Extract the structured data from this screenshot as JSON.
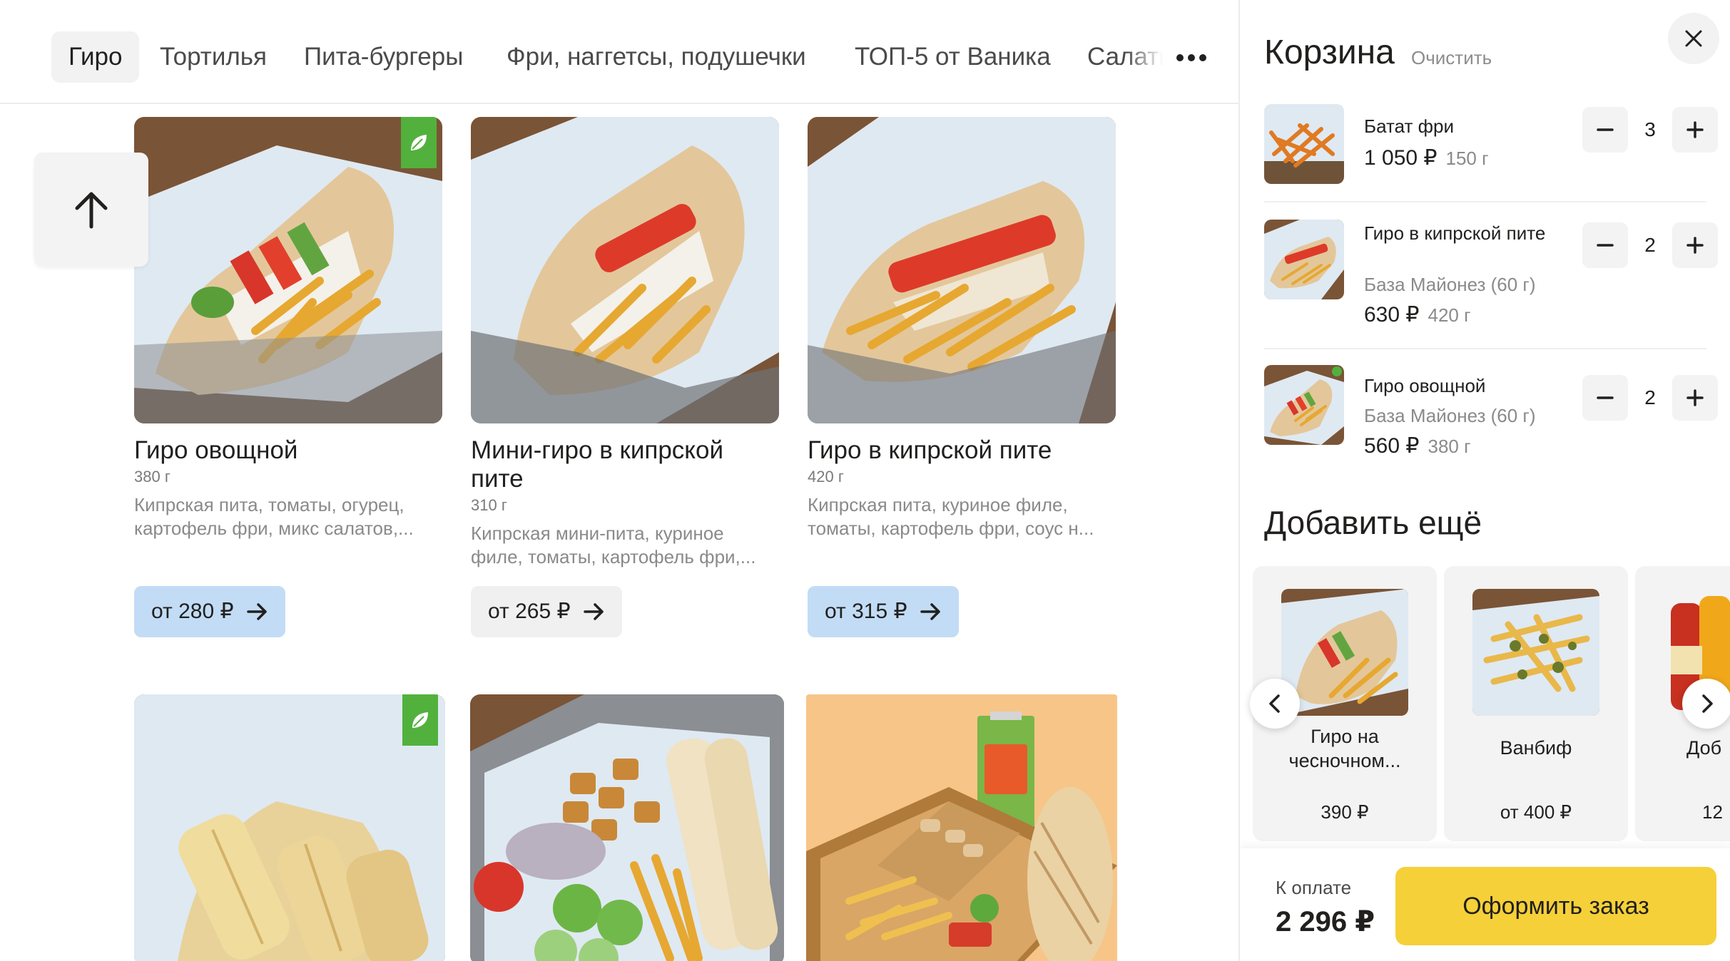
{
  "tabs": [
    {
      "label": "Гиро",
      "active": true
    },
    {
      "label": "Тортилья"
    },
    {
      "label": "Пита-бургеры"
    },
    {
      "label": "Фри, наггетсы, подушечки"
    },
    {
      "label": "ТОП-5 от Ваника"
    },
    {
      "label": "Салаты"
    }
  ],
  "products": [
    {
      "name": "Гиро овощной",
      "weight": "380 г",
      "desc": "Кипрская пита, томаты, огурец, картофель фри, микс салатов,...",
      "price": "от 280 ₽",
      "in_cart": true,
      "veg": true
    },
    {
      "name": "Мини-гиро в кипрской пите",
      "weight": "310 г",
      "desc": "Кипрская мини-пита, куриное филе, томаты, картофель фри,...",
      "price": "от 265 ₽",
      "in_cart": false,
      "veg": false
    },
    {
      "name": "Гиро в кипрской пите",
      "weight": "420 г",
      "desc": "Кипрская пита, куриное филе, томаты, картофель фри, соус н...",
      "price": "от 315 ₽",
      "in_cart": true,
      "veg": false
    }
  ],
  "cart": {
    "title": "Корзина",
    "clear_label": "Очистить",
    "items": [
      {
        "name": "Батат фри",
        "modifier": "",
        "price": "1 050 ₽",
        "weight": "150 г",
        "qty": "3"
      },
      {
        "name": "Гиро в кипрской пите",
        "modifier": "База Майонез (60 г)",
        "price": "630 ₽",
        "weight": "420 г",
        "qty": "2"
      },
      {
        "name": "Гиро овощной",
        "modifier": "База Майонез (60 г)",
        "price": "560 ₽",
        "weight": "380 г",
        "qty": "2"
      }
    ],
    "more_title": "Добавить ещё",
    "suggestions": [
      {
        "name": "Гиро на чесночном...",
        "price": "390 ₽"
      },
      {
        "name": "Ванбиф",
        "price": "от 400 ₽"
      },
      {
        "name": "Доб",
        "price": "12"
      }
    ],
    "pay_label": "К оплате",
    "total": "2 296 ₽",
    "checkout_label": "Оформить заказ"
  },
  "colors": {
    "accent_yellow": "#f6d038",
    "price_blue": "#c2dcf6",
    "veg_green": "#52b13c",
    "muted_text": "#8a8a8a"
  }
}
